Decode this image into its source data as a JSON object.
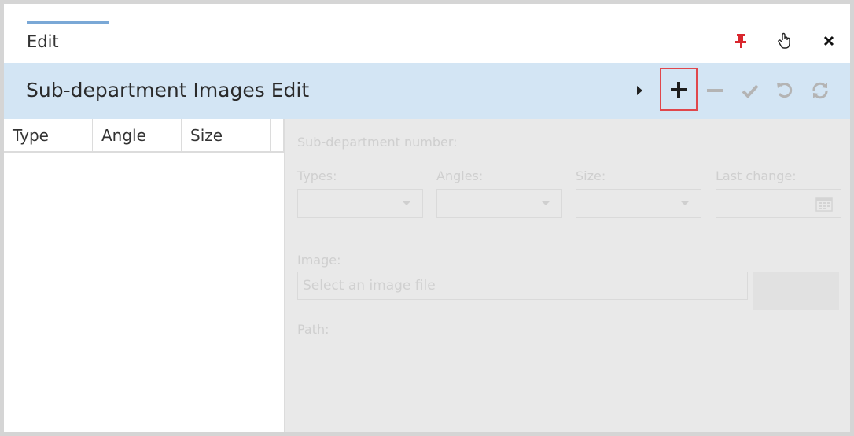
{
  "window": {
    "title": "Edit"
  },
  "toolbar": {
    "section_title": "Sub-department Images Edit",
    "buttons": [
      "expand",
      "add",
      "remove",
      "confirm",
      "undo",
      "refresh"
    ],
    "highlight_color": "#e0474c",
    "add_icon": "plus-icon"
  },
  "grid": {
    "columns": [
      "Type",
      "Angle",
      "Size"
    ],
    "rows": []
  },
  "form": {
    "subdept_label": "Sub-department number:",
    "types_label": "Types:",
    "angles_label": "Angles:",
    "size_label": "Size:",
    "last_change_label": "Last change:",
    "image_label": "Image:",
    "image_placeholder": "Select an image file",
    "path_label": "Path:"
  },
  "colors": {
    "toolbar_bg": "#d3e5f4",
    "accent": "#7aa8d6",
    "pin": "#d9272e"
  }
}
